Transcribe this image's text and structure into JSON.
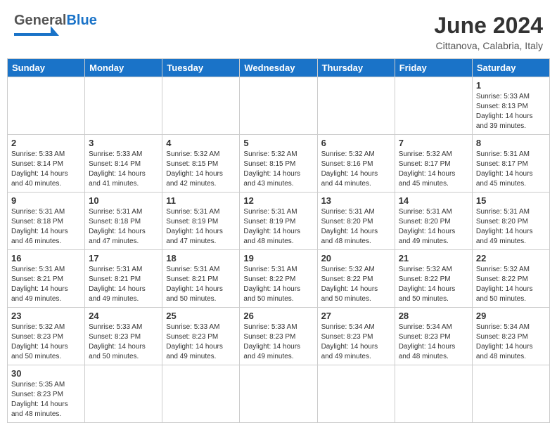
{
  "header": {
    "logo_general": "General",
    "logo_blue": "Blue",
    "month_title": "June 2024",
    "subtitle": "Cittanova, Calabria, Italy"
  },
  "days_of_week": [
    "Sunday",
    "Monday",
    "Tuesday",
    "Wednesday",
    "Thursday",
    "Friday",
    "Saturday"
  ],
  "weeks": [
    [
      {
        "day": "",
        "info": ""
      },
      {
        "day": "",
        "info": ""
      },
      {
        "day": "",
        "info": ""
      },
      {
        "day": "",
        "info": ""
      },
      {
        "day": "",
        "info": ""
      },
      {
        "day": "",
        "info": ""
      },
      {
        "day": "1",
        "info": "Sunrise: 5:33 AM\nSunset: 8:13 PM\nDaylight: 14 hours\nand 39 minutes."
      }
    ],
    [
      {
        "day": "2",
        "info": "Sunrise: 5:33 AM\nSunset: 8:14 PM\nDaylight: 14 hours\nand 40 minutes."
      },
      {
        "day": "3",
        "info": "Sunrise: 5:33 AM\nSunset: 8:14 PM\nDaylight: 14 hours\nand 41 minutes."
      },
      {
        "day": "4",
        "info": "Sunrise: 5:32 AM\nSunset: 8:15 PM\nDaylight: 14 hours\nand 42 minutes."
      },
      {
        "day": "5",
        "info": "Sunrise: 5:32 AM\nSunset: 8:15 PM\nDaylight: 14 hours\nand 43 minutes."
      },
      {
        "day": "6",
        "info": "Sunrise: 5:32 AM\nSunset: 8:16 PM\nDaylight: 14 hours\nand 44 minutes."
      },
      {
        "day": "7",
        "info": "Sunrise: 5:32 AM\nSunset: 8:17 PM\nDaylight: 14 hours\nand 45 minutes."
      },
      {
        "day": "8",
        "info": "Sunrise: 5:31 AM\nSunset: 8:17 PM\nDaylight: 14 hours\nand 45 minutes."
      }
    ],
    [
      {
        "day": "9",
        "info": "Sunrise: 5:31 AM\nSunset: 8:18 PM\nDaylight: 14 hours\nand 46 minutes."
      },
      {
        "day": "10",
        "info": "Sunrise: 5:31 AM\nSunset: 8:18 PM\nDaylight: 14 hours\nand 47 minutes."
      },
      {
        "day": "11",
        "info": "Sunrise: 5:31 AM\nSunset: 8:19 PM\nDaylight: 14 hours\nand 47 minutes."
      },
      {
        "day": "12",
        "info": "Sunrise: 5:31 AM\nSunset: 8:19 PM\nDaylight: 14 hours\nand 48 minutes."
      },
      {
        "day": "13",
        "info": "Sunrise: 5:31 AM\nSunset: 8:20 PM\nDaylight: 14 hours\nand 48 minutes."
      },
      {
        "day": "14",
        "info": "Sunrise: 5:31 AM\nSunset: 8:20 PM\nDaylight: 14 hours\nand 49 minutes."
      },
      {
        "day": "15",
        "info": "Sunrise: 5:31 AM\nSunset: 8:20 PM\nDaylight: 14 hours\nand 49 minutes."
      }
    ],
    [
      {
        "day": "16",
        "info": "Sunrise: 5:31 AM\nSunset: 8:21 PM\nDaylight: 14 hours\nand 49 minutes."
      },
      {
        "day": "17",
        "info": "Sunrise: 5:31 AM\nSunset: 8:21 PM\nDaylight: 14 hours\nand 49 minutes."
      },
      {
        "day": "18",
        "info": "Sunrise: 5:31 AM\nSunset: 8:21 PM\nDaylight: 14 hours\nand 50 minutes."
      },
      {
        "day": "19",
        "info": "Sunrise: 5:31 AM\nSunset: 8:22 PM\nDaylight: 14 hours\nand 50 minutes."
      },
      {
        "day": "20",
        "info": "Sunrise: 5:32 AM\nSunset: 8:22 PM\nDaylight: 14 hours\nand 50 minutes."
      },
      {
        "day": "21",
        "info": "Sunrise: 5:32 AM\nSunset: 8:22 PM\nDaylight: 14 hours\nand 50 minutes."
      },
      {
        "day": "22",
        "info": "Sunrise: 5:32 AM\nSunset: 8:22 PM\nDaylight: 14 hours\nand 50 minutes."
      }
    ],
    [
      {
        "day": "23",
        "info": "Sunrise: 5:32 AM\nSunset: 8:23 PM\nDaylight: 14 hours\nand 50 minutes."
      },
      {
        "day": "24",
        "info": "Sunrise: 5:33 AM\nSunset: 8:23 PM\nDaylight: 14 hours\nand 50 minutes."
      },
      {
        "day": "25",
        "info": "Sunrise: 5:33 AM\nSunset: 8:23 PM\nDaylight: 14 hours\nand 49 minutes."
      },
      {
        "day": "26",
        "info": "Sunrise: 5:33 AM\nSunset: 8:23 PM\nDaylight: 14 hours\nand 49 minutes."
      },
      {
        "day": "27",
        "info": "Sunrise: 5:34 AM\nSunset: 8:23 PM\nDaylight: 14 hours\nand 49 minutes."
      },
      {
        "day": "28",
        "info": "Sunrise: 5:34 AM\nSunset: 8:23 PM\nDaylight: 14 hours\nand 48 minutes."
      },
      {
        "day": "29",
        "info": "Sunrise: 5:34 AM\nSunset: 8:23 PM\nDaylight: 14 hours\nand 48 minutes."
      }
    ],
    [
      {
        "day": "30",
        "info": "Sunrise: 5:35 AM\nSunset: 8:23 PM\nDaylight: 14 hours\nand 48 minutes."
      },
      {
        "day": "",
        "info": ""
      },
      {
        "day": "",
        "info": ""
      },
      {
        "day": "",
        "info": ""
      },
      {
        "day": "",
        "info": ""
      },
      {
        "day": "",
        "info": ""
      },
      {
        "day": "",
        "info": ""
      }
    ]
  ]
}
